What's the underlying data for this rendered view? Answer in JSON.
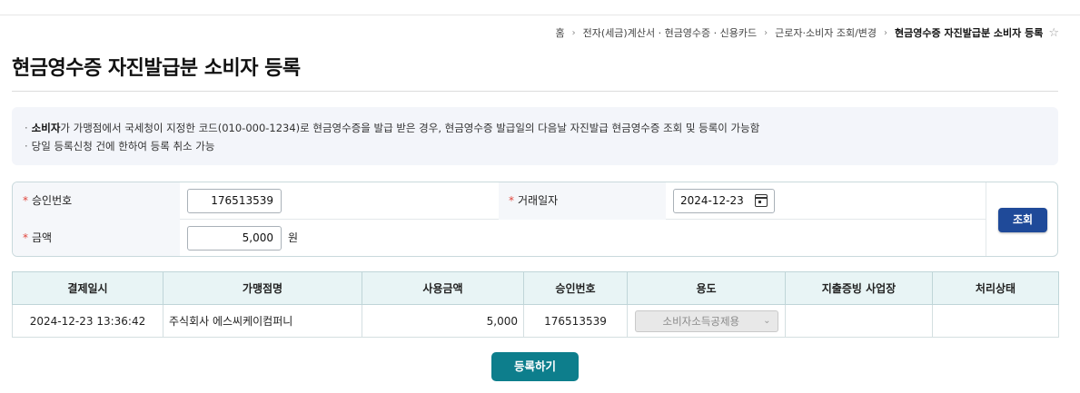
{
  "breadcrumb": {
    "items": [
      "홈",
      "전자(세금)계산서 · 현금영수증 · 신용카드",
      "근로자·소비자 조회/변경"
    ],
    "current": "현금영수증 자진발급분 소비자 등록",
    "separator": "›",
    "favorite_icon": "☆"
  },
  "page": {
    "title": "현금영수증 자진발급분 소비자 등록"
  },
  "notice": {
    "bullet": "·",
    "line1_bold": "소비자",
    "line1_rest": "가 가맹점에서 국세청이 지정한 코드(010-000-1234)로 현금영수증을 발급 받은 경우, 현금영수증 발급일의 다음날 자진발급 현금영수증 조회 및 등록이 가능함",
    "line2": "당일 등록신청 건에 한하여 등록 취소 가능"
  },
  "search": {
    "required_mark": "*",
    "approval_label": "승인번호",
    "approval_value": "176513539",
    "date_label": "거래일자",
    "date_value": "2024-12-23",
    "amount_label": "금액",
    "amount_value": "5,000",
    "amount_unit": "원",
    "search_button": "조회"
  },
  "table": {
    "headers": [
      "결제일시",
      "가맹점명",
      "사용금액",
      "승인번호",
      "용도",
      "지출증빙 사업장",
      "처리상태"
    ],
    "rows": [
      {
        "datetime": "2024-12-23 13:36:42",
        "merchant": "주식회사 에스씨케이컴퍼니",
        "amount": "5,000",
        "approval": "176513539",
        "purpose": "소비자소득공제용",
        "business": "",
        "status": ""
      }
    ]
  },
  "actions": {
    "register_button": "등록하기"
  },
  "colors": {
    "primary_blue": "#1f4a99",
    "register_teal": "#0d7e8c",
    "required_red": "#e0463d",
    "table_header_bg": "#e8f4f5"
  }
}
